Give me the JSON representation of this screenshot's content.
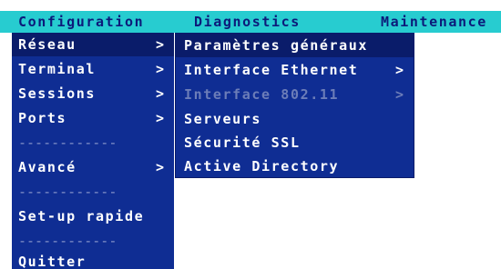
{
  "menubar": {
    "items": [
      {
        "label": "Configuration"
      },
      {
        "label": "Diagnostics"
      },
      {
        "label": "Maintenance"
      }
    ]
  },
  "config_menu": {
    "items": [
      {
        "label": "Réseau",
        "arrow": ">"
      },
      {
        "label": "Terminal",
        "arrow": ">"
      },
      {
        "label": "Sessions",
        "arrow": ">"
      },
      {
        "label": "Ports",
        "arrow": ">"
      },
      {
        "label": "Avancé",
        "arrow": ">"
      },
      {
        "label": "Set-up rapide"
      },
      {
        "label": "Quitter"
      }
    ],
    "separator": "------------"
  },
  "network_submenu": {
    "items": [
      {
        "label": "Paramètres généraux"
      },
      {
        "label": "Interface Ethernet",
        "arrow": ">"
      },
      {
        "label": "Interface 802.11",
        "arrow": ">"
      },
      {
        "label": "Serveurs"
      },
      {
        "label": "Sécurité SSL"
      },
      {
        "label": "Active Directory"
      }
    ]
  }
}
